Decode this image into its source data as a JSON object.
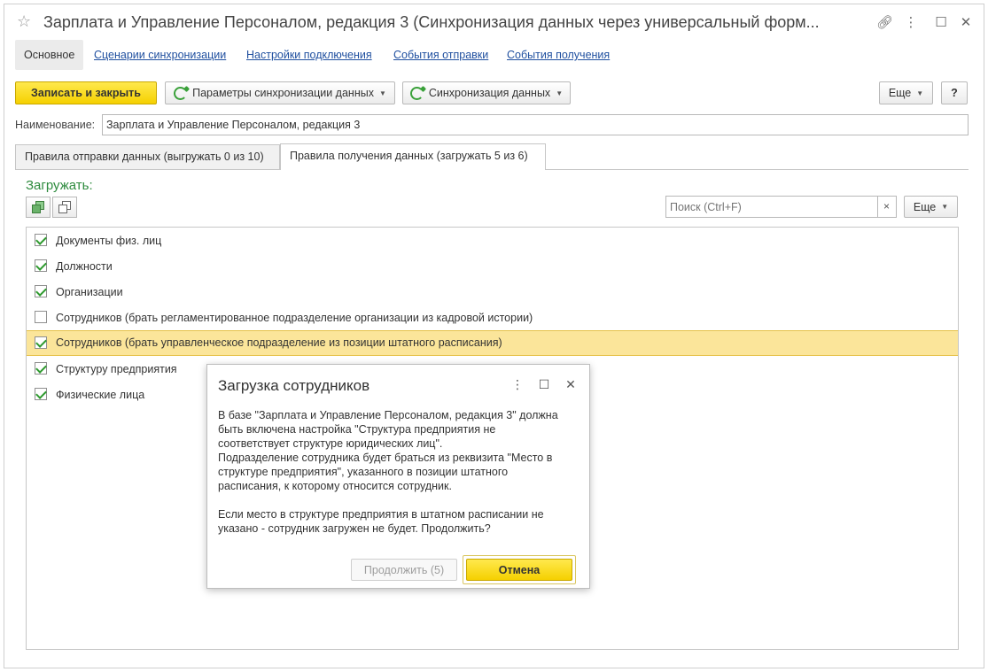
{
  "window": {
    "title": "Зарплата и Управление Персоналом, редакция 3 (Синхронизация данных через универсальный форм..."
  },
  "nav": {
    "main": "Основное",
    "links": [
      "Сценарии синхронизации",
      "Настройки подключения",
      "События отправки",
      "События получения"
    ]
  },
  "toolbar": {
    "save_close": "Записать и закрыть",
    "sync_params": "Параметры синхронизации данных",
    "sync": "Синхронизация данных",
    "more": "Еще",
    "help": "?"
  },
  "name": {
    "label": "Наименование:",
    "value": "Зарплата и Управление Персоналом, редакция 3"
  },
  "tabs": [
    "Правила отправки данных (выгружать 0 из 10)",
    "Правила получения данных (загружать 5 из 6)"
  ],
  "section": {
    "title": "Загружать:",
    "search_placeholder": "Поиск (Ctrl+F)",
    "clear": "×",
    "more": "Еще"
  },
  "items": [
    {
      "label": "Документы физ. лиц",
      "checked": true
    },
    {
      "label": "Должности",
      "checked": true
    },
    {
      "label": "Организации",
      "checked": true
    },
    {
      "label": "Сотрудников (брать регламентированное подразделение организации из кадровой истории)",
      "checked": false
    },
    {
      "label": "Сотрудников (брать управленческое подразделение из позиции штатного расписания)",
      "checked": true
    },
    {
      "label": "Структуру предприятия",
      "checked": true
    },
    {
      "label": "Физические лица",
      "checked": true
    }
  ],
  "dialog": {
    "title": "Загрузка сотрудников",
    "lines": [
      "В базе \"Зарплата и Управление Персоналом, редакция 3\" должна",
      "быть включена настройка \"Структура предприятия не",
      "соответствует структуре юридических лиц\".",
      "Подразделение сотрудника будет браться из реквизита \"Место в",
      "структуре предприятия\", указанного в позиции штатного",
      "расписания, к которому относится сотрудник.",
      "",
      "Если место в структуре предприятия в штатном расписании не",
      "указано - сотрудник загружен не будет. Продолжить?"
    ],
    "continue": "Продолжить (5)",
    "cancel": "Отмена"
  },
  "colors": {
    "accent_yellow": "#f5d000",
    "link_blue": "#1f4f9f",
    "section_green": "#2e8b3e",
    "selected_row": "#fbe59a"
  }
}
